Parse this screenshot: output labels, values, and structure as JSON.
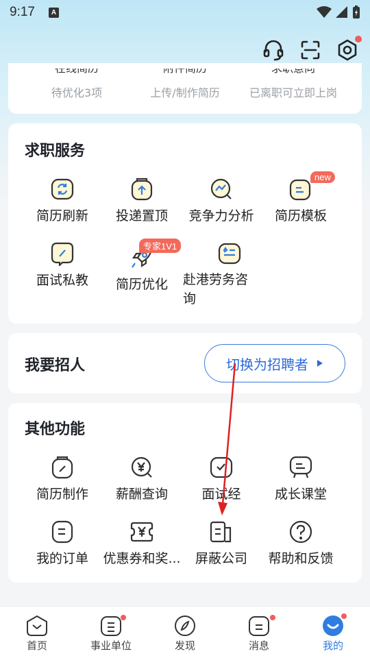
{
  "status_bar": {
    "time": "9:17",
    "a_label": "A"
  },
  "profile_stats": [
    {
      "title_clipped": "在线简历",
      "sub": "待优化3项"
    },
    {
      "title_clipped": "附件简历",
      "sub": "上传/制作简历"
    },
    {
      "title_clipped": "求职意向",
      "sub": "已离职可立即上岗"
    }
  ],
  "job_services": {
    "title": "求职服务",
    "items": [
      {
        "label": "简历刷新",
        "icon": "refresh-doc-icon"
      },
      {
        "label": "投递置顶",
        "icon": "pin-top-icon"
      },
      {
        "label": "竞争力分析",
        "icon": "analysis-icon"
      },
      {
        "label": "简历模板",
        "icon": "template-icon",
        "badge": "new"
      },
      {
        "label": "面试私教",
        "icon": "interview-coach-icon"
      },
      {
        "label": "简历优化",
        "icon": "rocket-icon",
        "badge": "专家1V1"
      },
      {
        "label": "赴港劳务咨询",
        "icon": "consult-icon"
      }
    ]
  },
  "recruit": {
    "title": "我要招人",
    "switch_label": "切换为招聘者"
  },
  "other_functions": {
    "title": "其他功能",
    "items": [
      {
        "label": "简历制作",
        "icon": "resume-edit-icon"
      },
      {
        "label": "薪酬查询",
        "icon": "salary-search-icon"
      },
      {
        "label": "面试经",
        "icon": "interview-check-icon"
      },
      {
        "label": "成长课堂",
        "icon": "classroom-icon"
      },
      {
        "label": "我的订单",
        "icon": "order-icon"
      },
      {
        "label": "优惠券和奖...",
        "icon": "coupon-icon"
      },
      {
        "label": "屏蔽公司",
        "icon": "block-company-icon"
      },
      {
        "label": "帮助和反馈",
        "icon": "help-icon"
      }
    ]
  },
  "bottom_nav": [
    {
      "label": "首页",
      "icon": "home-icon"
    },
    {
      "label": "事业单位",
      "icon": "institution-icon"
    },
    {
      "label": "发现",
      "icon": "discover-icon"
    },
    {
      "label": "消息",
      "icon": "message-icon"
    },
    {
      "label": "我的",
      "icon": "profile-icon",
      "active": true
    }
  ],
  "colors": {
    "accent": "#2f7de1",
    "badge": "#f26a5b",
    "annotation": "#e02020"
  }
}
